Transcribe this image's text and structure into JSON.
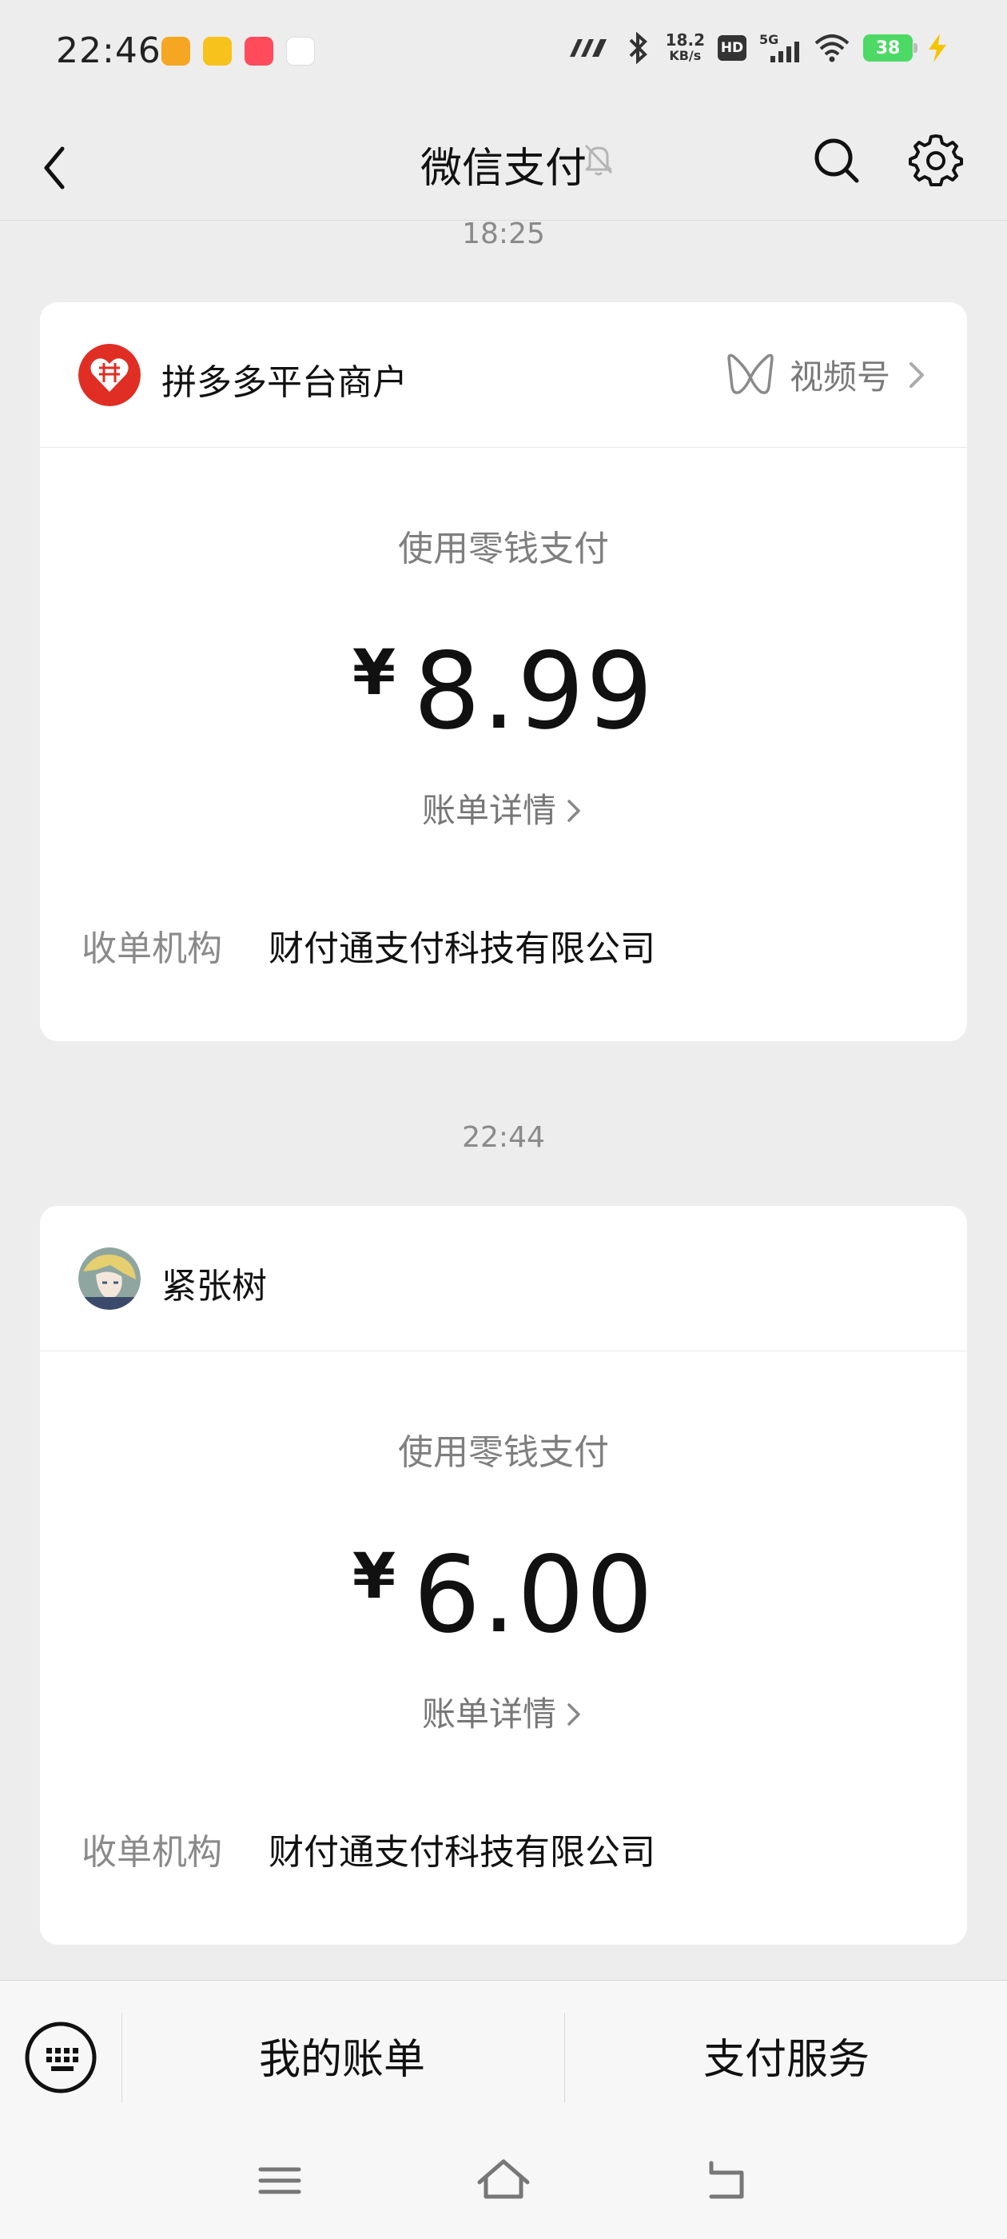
{
  "status_bar": {
    "time": "22:46",
    "network_speed_value": "18.2",
    "network_speed_unit": "KB/s",
    "hd_label": "HD",
    "cell_label": "5G",
    "battery_level": "38",
    "app_icons": [
      "app-icon-1",
      "app-icon-2",
      "app-icon-3",
      "app-icon-4"
    ]
  },
  "nav": {
    "title": "微信支付"
  },
  "payments": [
    {
      "time": "18:25",
      "merchant": "拼多多平台商户",
      "channel_label": "视频号",
      "method": "使用零钱支付",
      "currency": "¥",
      "amount": "8.99",
      "detail_label": "账单详情",
      "org_label": "收单机构",
      "org_value": "财付通支付科技有限公司"
    },
    {
      "time": "22:44",
      "merchant": "紧张树",
      "method": "使用零钱支付",
      "currency": "¥",
      "amount": "6.00",
      "detail_label": "账单详情",
      "org_label": "收单机构",
      "org_value": "财付通支付科技有限公司"
    }
  ],
  "bottom_tabs": {
    "my_bills": "我的账单",
    "pay_services": "支付服务"
  },
  "colors": {
    "background": "#ededed",
    "card": "#ffffff",
    "pdd_red": "#e02e24",
    "battery_green": "#4cd964"
  }
}
